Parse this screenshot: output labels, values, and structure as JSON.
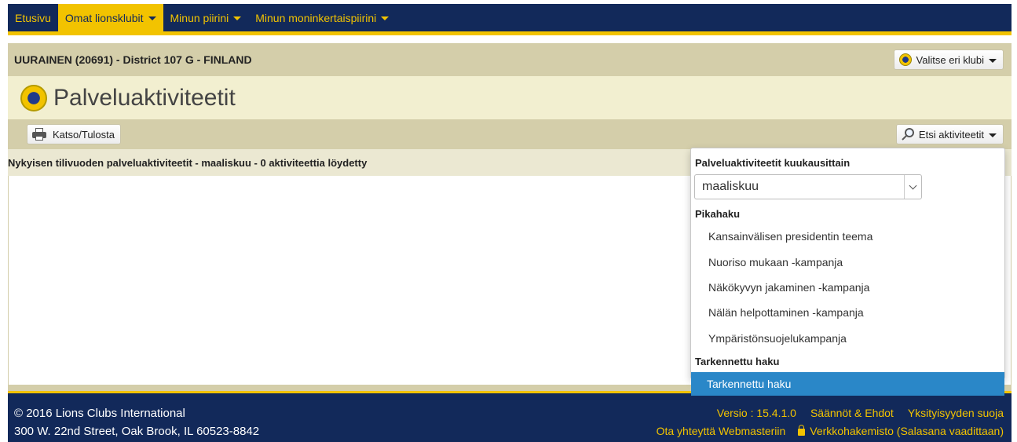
{
  "nav": {
    "items": [
      {
        "label": "Etusivu",
        "active": false,
        "dropdown": false
      },
      {
        "label": "Omat lionsklubit",
        "active": true,
        "dropdown": true
      },
      {
        "label": "Minun piirini",
        "active": false,
        "dropdown": true
      },
      {
        "label": "Minun moninkertaispiirini",
        "active": false,
        "dropdown": true
      }
    ]
  },
  "club": {
    "title": "UURAINEN (20691) - District 107 G - FINLAND",
    "select_label": "Valitse eri klubi"
  },
  "page": {
    "title": "Palveluaktiviteetit"
  },
  "toolbar": {
    "print_label": "Katso/Tulosta",
    "search_label": "Etsi aktiviteetit"
  },
  "results": {
    "text": "Nykyisen tilivuoden palveluaktiviteetit - maaliskuu - 0 aktiviteettia löydetty"
  },
  "dropdown": {
    "month_heading": "Palveluaktiviteetit kuukausittain",
    "month_value": "maaliskuu",
    "quick_heading": "Pikahaku",
    "quick_items": [
      "Kansainvälisen presidentin teema",
      "Nuoriso mukaan -kampanja",
      "Näkökyvyn jakaminen -kampanja",
      "Nälän helpottaminen -kampanja",
      "Ympäristönsuojelukampanja"
    ],
    "advanced_heading": "Tarkennettu haku",
    "advanced_item": "Tarkennettu haku"
  },
  "footer": {
    "copyright": "© 2016 Lions Clubs International",
    "address": "300 W. 22nd Street, Oak Brook, IL 60523-8842",
    "version": "Versio : 15.4.1.0",
    "terms": "Säännöt & Ehdot",
    "privacy": "Yksityisyyden suoja",
    "contact": "Ota yhteyttä Webmasteriin",
    "directory": "Verkkohakemisto (Salasana vaadittaan)"
  },
  "colors": {
    "navy": "#12295a",
    "gold": "#f2c300",
    "tan": "#d4ceaa",
    "cream": "#f2efd0",
    "highlight": "#2a87c8"
  }
}
